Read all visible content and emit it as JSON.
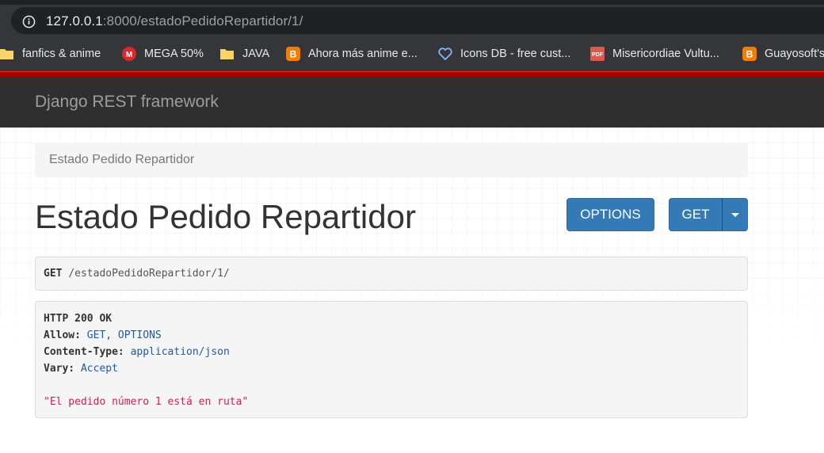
{
  "browser": {
    "url_host": "127.0.0.1",
    "url_rest": ":8000/estadoPedidoRepartidor/1/",
    "bookmarks": [
      {
        "label": "fanfics & anime",
        "icon": "folder-icon"
      },
      {
        "label": "MEGA 50%",
        "icon": "mega-icon"
      },
      {
        "label": "JAVA",
        "icon": "folder-icon"
      },
      {
        "label": "Ahora más anime e...",
        "icon": "blogger-icon"
      },
      {
        "label": "Icons DB - free cust...",
        "icon": "heart-icon"
      },
      {
        "label": "Misericordiae Vultu...",
        "icon": "pdf-icon"
      },
      {
        "label": "Guayosoft's",
        "icon": "blogger-icon"
      }
    ]
  },
  "navbar": {
    "brand": "Django REST framework"
  },
  "breadcrumb": {
    "label": "Estado Pedido Repartidor"
  },
  "page": {
    "title": "Estado Pedido Repartidor"
  },
  "buttons": {
    "options": "OPTIONS",
    "get": "GET"
  },
  "request": {
    "method": "GET",
    "path": "/estadoPedidoRepartidor/1/"
  },
  "response": {
    "status": "HTTP 200 OK",
    "headers": [
      {
        "name": "Allow:",
        "value": "GET, OPTIONS"
      },
      {
        "name": "Content-Type:",
        "value": "application/json"
      },
      {
        "name": "Vary:",
        "value": "Accept"
      }
    ],
    "body": "\"El pedido número 1 está en ruta\""
  },
  "colors": {
    "navbar": "#2f2f2f",
    "accent_red": "#a30000",
    "button_primary": "#337ab7"
  }
}
